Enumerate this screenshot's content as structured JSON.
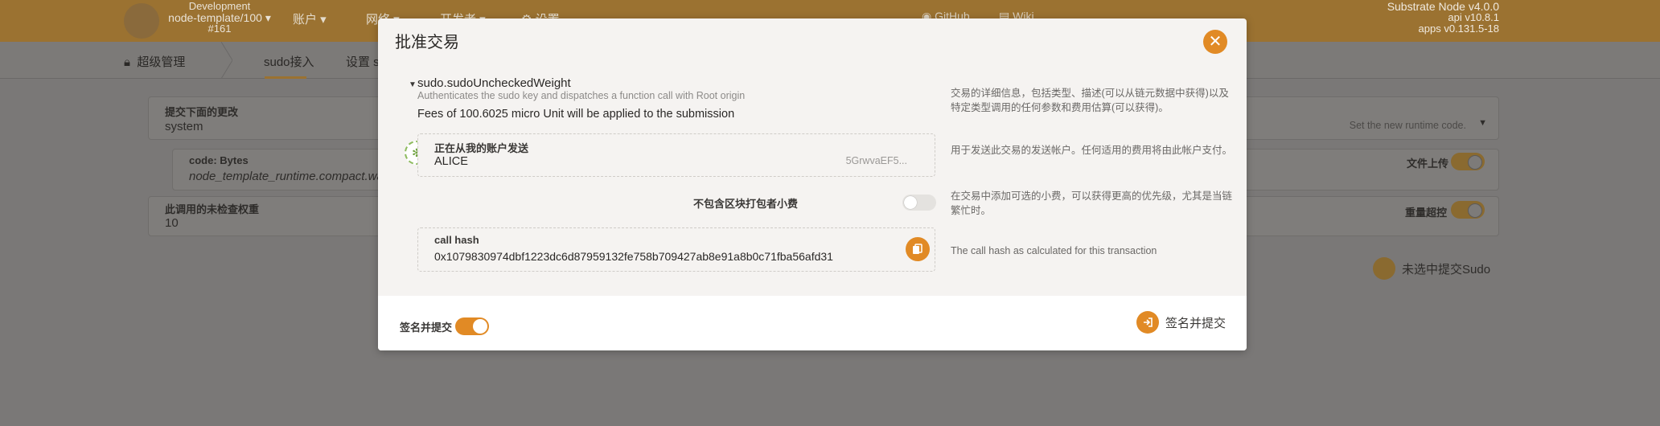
{
  "colors": {
    "accent": "#e18a25",
    "topbar": "#9b7231"
  },
  "header": {
    "chain_name": "Development",
    "node": "node-template/100",
    "block": "#161",
    "menu": [
      "账户",
      "网络",
      "开发者",
      "设置"
    ],
    "links": [
      "GitHub",
      "Wiki"
    ],
    "version": [
      "Substrate Node v4.0.0",
      "api v10.8.1",
      "apps v0.131.5-18"
    ]
  },
  "subnav": {
    "section": "超级管理",
    "tabs": [
      "sudo接入",
      "设置 s"
    ]
  },
  "background_form": {
    "submit_label": "提交下面的更改",
    "submit_value": "system",
    "method_hint": "Set the new runtime code.",
    "code_label": "code: Bytes",
    "code_value": "node_template_runtime.compact.wasm",
    "file_upload": "文件上传",
    "weight_label": "此调用的未检查权重",
    "weight_value": "10",
    "overweight": "重量超控",
    "submit_unchecked": "未选中提交Sudo"
  },
  "modal": {
    "title": "批准交易",
    "call_name": "sudo.sudoUncheckedWeight",
    "call_desc": "Authenticates the sudo key and dispatches a function call with Root origin",
    "fees": "Fees of 100.6025 micro Unit will be applied to the submission",
    "hint_call": "交易的详细信息，包括类型、描述(可以从链元数据中获得)以及特定类型调用的任何参数和费用估算(可以获得)。",
    "sender_label": "正在从我的账户发送",
    "sender_name": "ALICE",
    "sender_addr": "5GrwvaEF5...",
    "hint_sender": "用于发送此交易的发送帐户。任何适用的费用将由此帐户支付。",
    "tip_label": "不包含区块打包者小费",
    "hint_tip": "在交易中添加可选的小费，可以获得更高的优先级，尤其是当链繁忙时。",
    "hash_label": "call hash",
    "hash_value": "0x1079830974dbf1223dc6d87959132fe758b709427ab8e91a8b0c71fba56afd31",
    "hint_hash": "The call hash as calculated for this transaction",
    "sign_toggle_label": "签名并提交",
    "sign_button": "签名并提交"
  }
}
